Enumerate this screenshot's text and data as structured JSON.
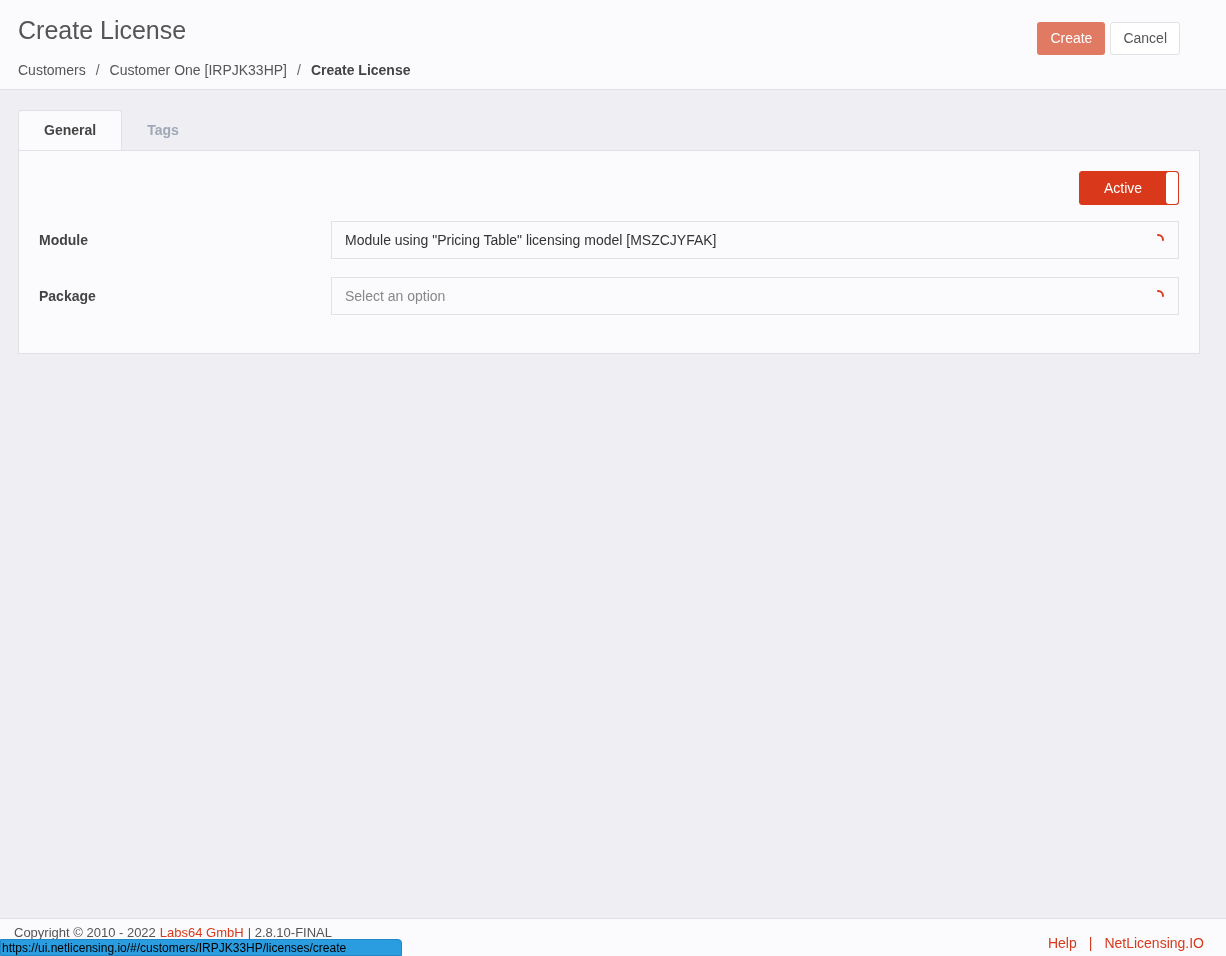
{
  "page": {
    "title": "Create License",
    "breadcrumb_separator": "/",
    "breadcrumb": [
      {
        "label": "Customers",
        "current": false
      },
      {
        "label": "Customer One [IRPJK33HP]",
        "current": false
      },
      {
        "label": "Create License",
        "current": true
      }
    ],
    "buttons": [
      {
        "label": "Create",
        "kind": "primary"
      },
      {
        "label": "Cancel",
        "kind": "secondary"
      }
    ]
  },
  "tabs": [
    {
      "label": "General",
      "selected": true
    },
    {
      "label": "Tags",
      "selected": false
    }
  ],
  "status_toggle": {
    "label": "Active",
    "on": true
  },
  "fields": [
    {
      "label": "Module",
      "value": "Module using \"Pricing Table\" licensing model [MSZCJYFAK]",
      "loading": true
    },
    {
      "label": "Package",
      "placeholder": "Select an option",
      "loading": true
    }
  ],
  "footer": {
    "copyright": "Copyright © 2010 - 2022",
    "company": "Labs64 GmbH",
    "version": "| 2.8.10-FINAL",
    "link_separator": "|",
    "links": [
      "Help",
      "NetLicensing.IO"
    ]
  },
  "status_url": "https://ui.netlicensing.io/#/customers/IRPJK33HP/licenses/create"
}
